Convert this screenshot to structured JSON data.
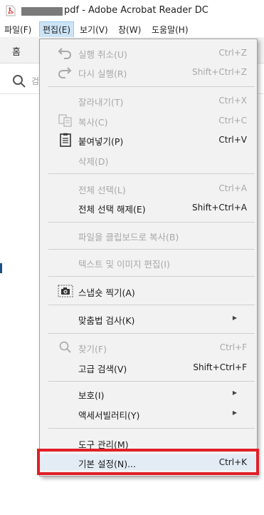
{
  "titlebar": {
    "title": "pdf - Adobe Acrobat Reader DC"
  },
  "menubar": {
    "items": [
      "파일(F)",
      "편집(E)",
      "보기(V)",
      "창(W)",
      "도움말(H)"
    ],
    "active": "편집(E)"
  },
  "toolbar": {
    "home_tab": "홈",
    "search_hint": "검"
  },
  "edit_menu": {
    "items": [
      {
        "label": "실행 취소(U)",
        "shortcut": "Ctrl+Z",
        "icon": "undo-icon",
        "enabled": false
      },
      {
        "label": "다시 실행(R)",
        "shortcut": "Shift+Ctrl+Z",
        "icon": "redo-icon",
        "enabled": false
      },
      {
        "label": "잘라내기(T)",
        "shortcut": "Ctrl+X",
        "icon": "",
        "enabled": false
      },
      {
        "label": "복사(C)",
        "shortcut": "Ctrl+C",
        "icon": "copy-icon",
        "enabled": false
      },
      {
        "label": "붙여넣기(P)",
        "shortcut": "Ctrl+V",
        "icon": "clipboard-icon",
        "enabled": true
      },
      {
        "label": "삭제(D)",
        "shortcut": "",
        "icon": "",
        "enabled": false
      },
      {
        "label": "전체 선택(L)",
        "shortcut": "Ctrl+A",
        "icon": "",
        "enabled": false
      },
      {
        "label": "전체 선택 해제(E)",
        "shortcut": "Shift+Ctrl+A",
        "icon": "",
        "enabled": true
      },
      {
        "label": "파일을 클립보드로 복사(B)",
        "shortcut": "",
        "icon": "",
        "enabled": false
      },
      {
        "label": "텍스트 및 이미지 편집(I)",
        "shortcut": "",
        "icon": "",
        "enabled": false
      },
      {
        "label": "스냅숏 찍기(A)",
        "shortcut": "",
        "icon": "camera-icon",
        "enabled": true
      },
      {
        "label": "맞춤법 검사(K)",
        "shortcut": "",
        "icon": "",
        "enabled": true,
        "submenu": true
      },
      {
        "label": "찾기(F)",
        "shortcut": "Ctrl+F",
        "icon": "search-icon",
        "enabled": false
      },
      {
        "label": "고급 검색(V)",
        "shortcut": "Shift+Ctrl+F",
        "icon": "",
        "enabled": true
      },
      {
        "label": "보호(I)",
        "shortcut": "",
        "icon": "",
        "enabled": true,
        "submenu": true
      },
      {
        "label": "액세서빌러티(Y)",
        "shortcut": "",
        "icon": "",
        "enabled": true,
        "submenu": true
      },
      {
        "label": "도구 관리(M)",
        "shortcut": "",
        "icon": "",
        "enabled": true
      },
      {
        "label": "기본 설정(N)...",
        "shortcut": "Ctrl+K",
        "icon": "",
        "enabled": true,
        "highlighted": true
      }
    ]
  },
  "colors": {
    "highlight_border": "#e01f28",
    "menu_bg": "#f2f2f2",
    "disabled_text": "#a8a8a8",
    "active_menu_bg": "#cce4f7"
  }
}
